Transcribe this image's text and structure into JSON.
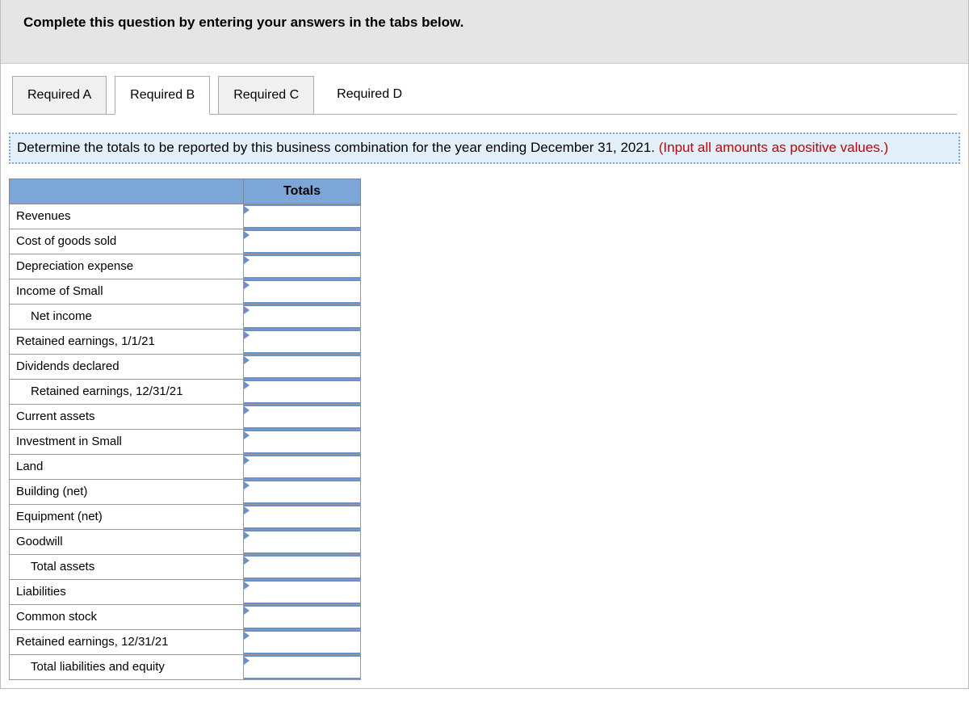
{
  "header": {
    "title": "Complete this question by entering your answers in the tabs below."
  },
  "tabs": [
    {
      "label": "Required A",
      "active": false
    },
    {
      "label": "Required B",
      "active": true
    },
    {
      "label": "Required C",
      "active": false
    },
    {
      "label": "Required D",
      "active": false,
      "noborder": true
    }
  ],
  "instruction": {
    "main": "Determine the totals to be reported by this business combination for the year ending December 31, 2021. ",
    "red": "(Input all amounts as positive values.)"
  },
  "table": {
    "totals_header": "Totals",
    "rows": [
      {
        "label": "Revenues",
        "indent": false,
        "has_input": true
      },
      {
        "label": "Cost of goods sold",
        "indent": false,
        "has_input": true
      },
      {
        "label": "Depreciation expense",
        "indent": false,
        "has_input": true
      },
      {
        "label": "Income of Small",
        "indent": false,
        "has_input": true
      },
      {
        "label": "Net income",
        "indent": true,
        "has_input": true
      },
      {
        "label": "Retained earnings, 1/1/21",
        "indent": false,
        "has_input": true
      },
      {
        "label": "Dividends declared",
        "indent": false,
        "has_input": true
      },
      {
        "label": "Retained earnings, 12/31/21",
        "indent": true,
        "has_input": true
      },
      {
        "label": "Current assets",
        "indent": false,
        "has_input": true
      },
      {
        "label": "Investment in Small",
        "indent": false,
        "has_input": true
      },
      {
        "label": "Land",
        "indent": false,
        "has_input": true
      },
      {
        "label": "Building (net)",
        "indent": false,
        "has_input": true
      },
      {
        "label": "Equipment (net)",
        "indent": false,
        "has_input": true
      },
      {
        "label": "Goodwill",
        "indent": false,
        "has_input": true
      },
      {
        "label": "Total assets",
        "indent": true,
        "has_input": true
      },
      {
        "label": "Liabilities",
        "indent": false,
        "has_input": true
      },
      {
        "label": "Common stock",
        "indent": false,
        "has_input": true
      },
      {
        "label": "Retained earnings, 12/31/21",
        "indent": false,
        "has_input": true
      },
      {
        "label": "Total liabilities and equity",
        "indent": true,
        "has_input": true
      }
    ]
  }
}
